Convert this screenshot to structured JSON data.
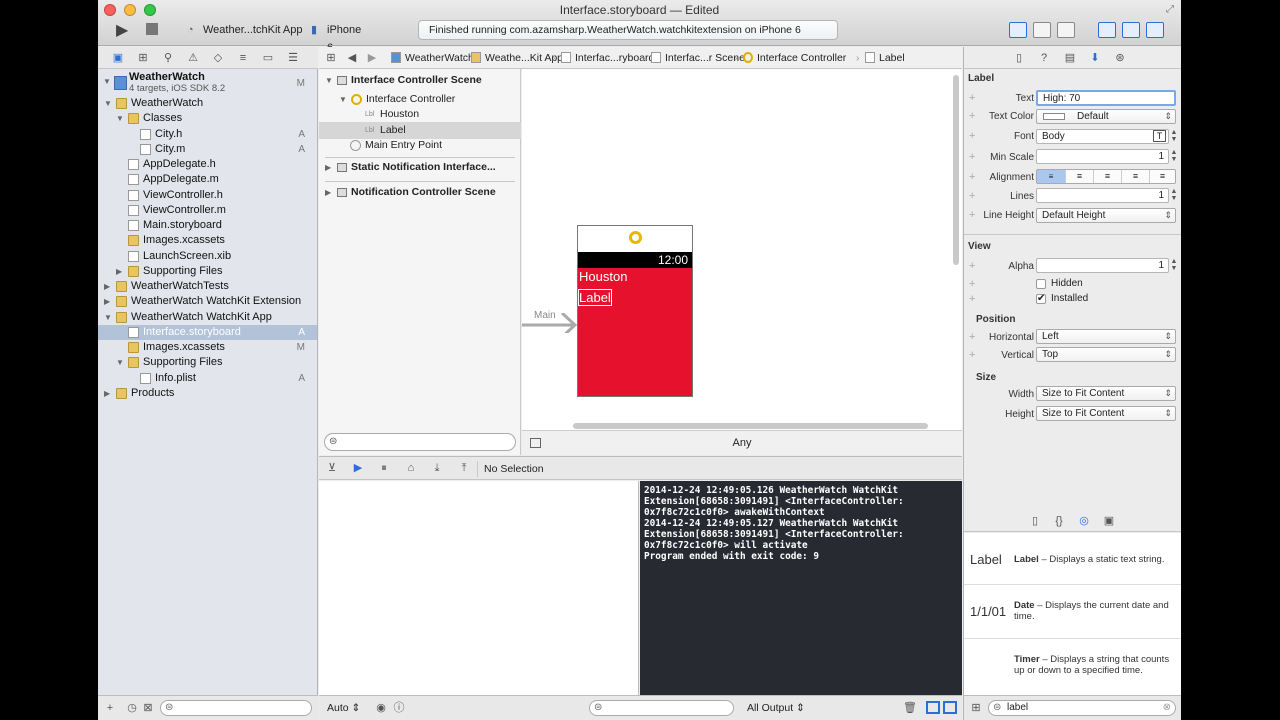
{
  "window": {
    "title": "Interface.storyboard — Edited",
    "scheme": "Weather...tchKit App",
    "device": "iPhone 6",
    "status": "Finished running com.azamsharp.WeatherWatch.watchkitextension on iPhone 6"
  },
  "navigator": {
    "project": {
      "name": "WeatherWatch",
      "sub": "4 targets, iOS SDK 8.2",
      "badge": "M"
    },
    "items": [
      {
        "label": "WeatherWatch",
        "badge": ""
      },
      {
        "label": "Classes",
        "badge": ""
      },
      {
        "label": "City.h",
        "badge": "A"
      },
      {
        "label": "City.m",
        "badge": "A"
      },
      {
        "label": "AppDelegate.h",
        "badge": ""
      },
      {
        "label": "AppDelegate.m",
        "badge": ""
      },
      {
        "label": "ViewController.h",
        "badge": ""
      },
      {
        "label": "ViewController.m",
        "badge": ""
      },
      {
        "label": "Main.storyboard",
        "badge": ""
      },
      {
        "label": "Images.xcassets",
        "badge": ""
      },
      {
        "label": "LaunchScreen.xib",
        "badge": ""
      },
      {
        "label": "Supporting Files",
        "badge": ""
      },
      {
        "label": "WeatherWatchTests",
        "badge": ""
      },
      {
        "label": "WeatherWatch WatchKit Extension",
        "badge": ""
      },
      {
        "label": "WeatherWatch WatchKit App",
        "badge": ""
      },
      {
        "label": "Interface.storyboard",
        "badge": "A"
      },
      {
        "label": "Images.xcassets",
        "badge": "M"
      },
      {
        "label": "Supporting Files",
        "badge": ""
      },
      {
        "label": "Info.plist",
        "badge": "A"
      },
      {
        "label": "Products",
        "badge": ""
      }
    ]
  },
  "jumpbar": [
    "WeatherWatch",
    "Weathe...Kit App",
    "Interfac...ryboard",
    "Interfac...r Scene",
    "Interface Controller",
    "Label"
  ],
  "outline": {
    "items": [
      "Interface Controller Scene",
      "Interface Controller",
      "Houston",
      "Label",
      "Main Entry Point",
      "Static Notification Interface...",
      "Notification Controller Scene"
    ]
  },
  "canvas": {
    "entry_label": "Main",
    "time": "12:00",
    "city": "Houston",
    "label": "Label",
    "size_class": "Any"
  },
  "debug": {
    "selection": "No Selection",
    "auto": "Auto ⇕",
    "output": "All Output ⇕",
    "console_lines": [
      "2014-12-24 12:49:05.126 WeatherWatch WatchKit",
      "Extension[68658:3091491] <InterfaceController:",
      "0x7f8c72c1c0f0> awakeWithContext",
      "2014-12-24 12:49:05.127 WeatherWatch WatchKit",
      "Extension[68658:3091491] <InterfaceController:",
      "0x7f8c72c1c0f0> will activate",
      "Program ended with exit code: 9"
    ]
  },
  "inspector": {
    "label_section": "Label",
    "text_label": "Text",
    "text_value": "High: 70",
    "textcolor_label": "Text Color",
    "textcolor_value": "Default",
    "font_label": "Font",
    "font_value": "Body",
    "minscale_label": "Min Scale",
    "minscale_value": "1",
    "alignment_label": "Alignment",
    "lines_label": "Lines",
    "lines_value": "1",
    "lineheight_label": "Line Height",
    "lineheight_value": "Default Height",
    "view_section": "View",
    "alpha_label": "Alpha",
    "alpha_value": "1",
    "hidden_label": "Hidden",
    "installed_label": "Installed",
    "position_section": "Position",
    "horizontal_label": "Horizontal",
    "horizontal_value": "Left",
    "vertical_label": "Vertical",
    "vertical_value": "Top",
    "size_section": "Size",
    "width_label": "Width",
    "width_value": "Size to Fit Content",
    "height_label": "Height",
    "height_value": "Size to Fit Content"
  },
  "library": {
    "items": [
      {
        "big": "Label",
        "name": "Label",
        "desc": " – Displays a static text string."
      },
      {
        "big": "1/1/01",
        "name": "Date",
        "desc": " – Displays the current date and time."
      },
      {
        "big": "",
        "name": "Timer",
        "desc": " – Displays a string that counts up or down to a specified time."
      }
    ],
    "search": "label"
  },
  "colors": {
    "accent": "#2d6ed6",
    "watch_red": "#e5112d",
    "console_bg": "#272a31"
  }
}
